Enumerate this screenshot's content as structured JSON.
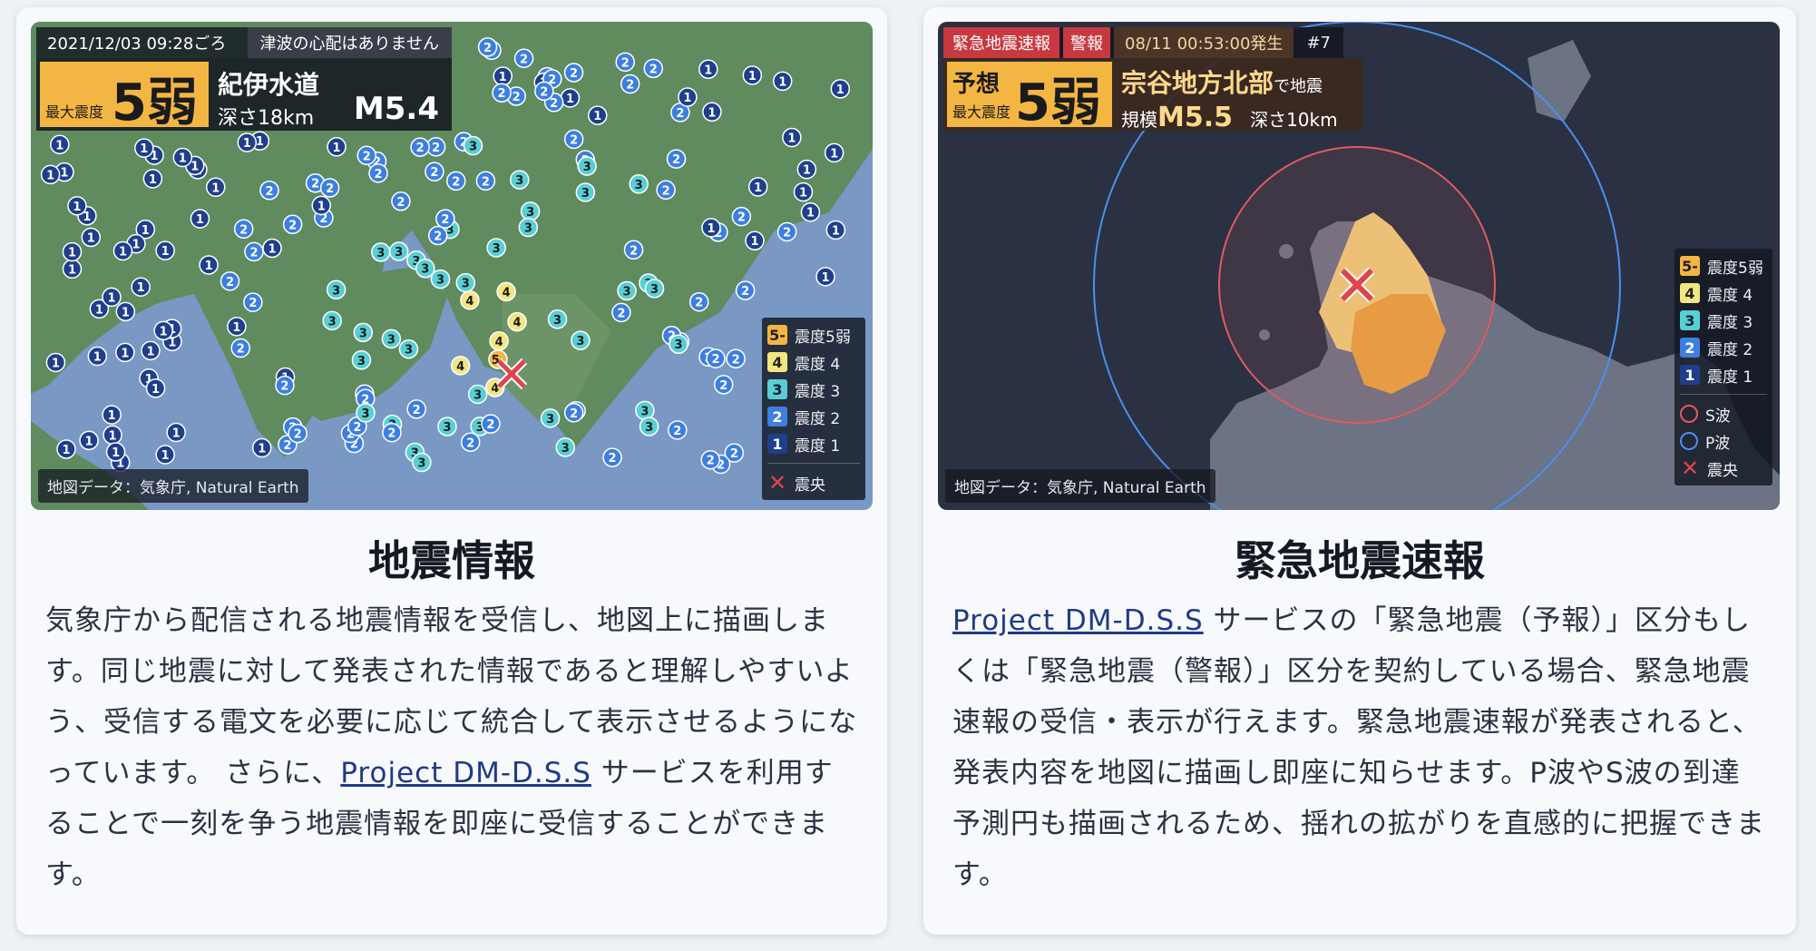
{
  "colors": {
    "shindo5lower": "#f4b642",
    "shindo4": "#f2e680",
    "shindo3": "#58cfd4",
    "shindo2": "#3d7fe0",
    "shindo1": "#1f3e8c",
    "s_wave": "#e05a60",
    "p_wave": "#4a8ff0",
    "epicenter": "#e0444c",
    "link": "#1f3b86"
  },
  "card1": {
    "title": "地震情報",
    "body_part1": "気象庁から配信される地震情報を受信し、地図上に描画します。同じ地震に対して発表された情報であると理解しやすいよう、受信する電文を必要に応じて統合して表示させるようになっています。 さらに、",
    "link_text": "Project DM-D.S.S",
    "body_part2": " サービスを利用することで一刻を争う地震情報を即座に受信することができます。",
    "map": {
      "time": "2021/12/03 09:28ごろ",
      "tsunami": "津波の心配はありません",
      "max_label": "最大震度",
      "max_value": "5弱",
      "place": "紀伊水道",
      "depth": "深さ18km",
      "magnitude": "M5.4",
      "credit": "地図データ：気象庁, Natural Earth",
      "legend": [
        {
          "badge": "5-",
          "label": "震度5弱",
          "icon": "shindo-5-lower-badge"
        },
        {
          "badge": "4",
          "label": "震度 4",
          "icon": "shindo-4-badge"
        },
        {
          "badge": "3",
          "label": "震度 3",
          "icon": "shindo-3-badge"
        },
        {
          "badge": "2",
          "label": "震度 2",
          "icon": "shindo-2-badge"
        },
        {
          "badge": "1",
          "label": "震度 1",
          "icon": "shindo-1-badge"
        }
      ],
      "epicenter_label": "震央"
    }
  },
  "card2": {
    "title": "緊急地震速報",
    "link_text": "Project DM-D.S.S",
    "body": " サービスの「緊急地震（予報）」区分もしくは「緊急地震（警報）」区分を契約している場合、緊急地震速報の受信・表示が行えます。緊急地震速報が発表されると、発表内容を地図に描画し即座に知らせます。P波やS波の到達予測円も描画されるため、揺れの拡がりを直感的に把握できます。",
    "map": {
      "tag1": "緊急地震速報",
      "tag2": "警報",
      "time": "08/11 00:53:00発生",
      "serial": "#7",
      "pred_label": "予想",
      "max_label": "最大震度",
      "max_value": "5弱",
      "place": "宗谷地方北部",
      "place_suffix": "で地震",
      "scale_label": "規模",
      "magnitude": "M5.5",
      "depth": "深さ10km",
      "credit": "地図データ：気象庁, Natural Earth",
      "legend": [
        {
          "badge": "5-",
          "label": "震度5弱"
        },
        {
          "badge": "4",
          "label": "震度 4"
        },
        {
          "badge": "3",
          "label": "震度 3"
        },
        {
          "badge": "2",
          "label": "震度 2"
        },
        {
          "badge": "1",
          "label": "震度 1"
        }
      ],
      "s_wave_label": "S波",
      "p_wave_label": "P波",
      "epicenter_label": "震央"
    }
  }
}
